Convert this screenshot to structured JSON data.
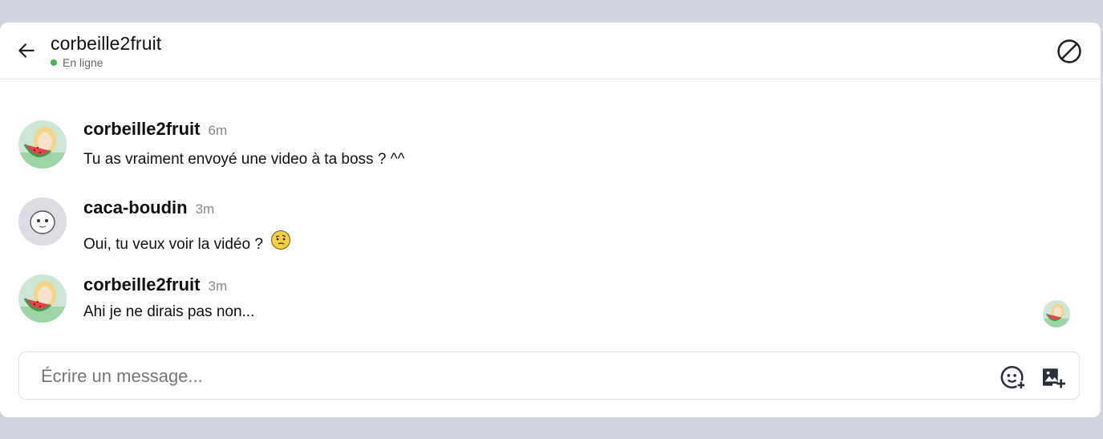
{
  "header": {
    "title": "corbeille2fruit",
    "status": "En ligne",
    "status_color": "#4caf50"
  },
  "messages": [
    {
      "author": "corbeille2fruit",
      "time": "6m",
      "text": "Tu as vraiment envoyé une video à ta boss ? ^^",
      "avatar": "watermelon-girl"
    },
    {
      "author": "caca-boudin",
      "time": "3m",
      "text": "Oui, tu veux voir la vidéo ?",
      "emoji": "thinking-face",
      "avatar": "default-face"
    },
    {
      "author": "corbeille2fruit",
      "time": "3m",
      "text": "Ahi je ne dirais pas non...",
      "avatar": "watermelon-girl"
    }
  ],
  "composer": {
    "placeholder": "Écrire un message..."
  },
  "icons": {
    "back": "arrow-left-icon",
    "block": "block-icon",
    "emoji": "emoji-add-icon",
    "image": "image-add-icon"
  }
}
